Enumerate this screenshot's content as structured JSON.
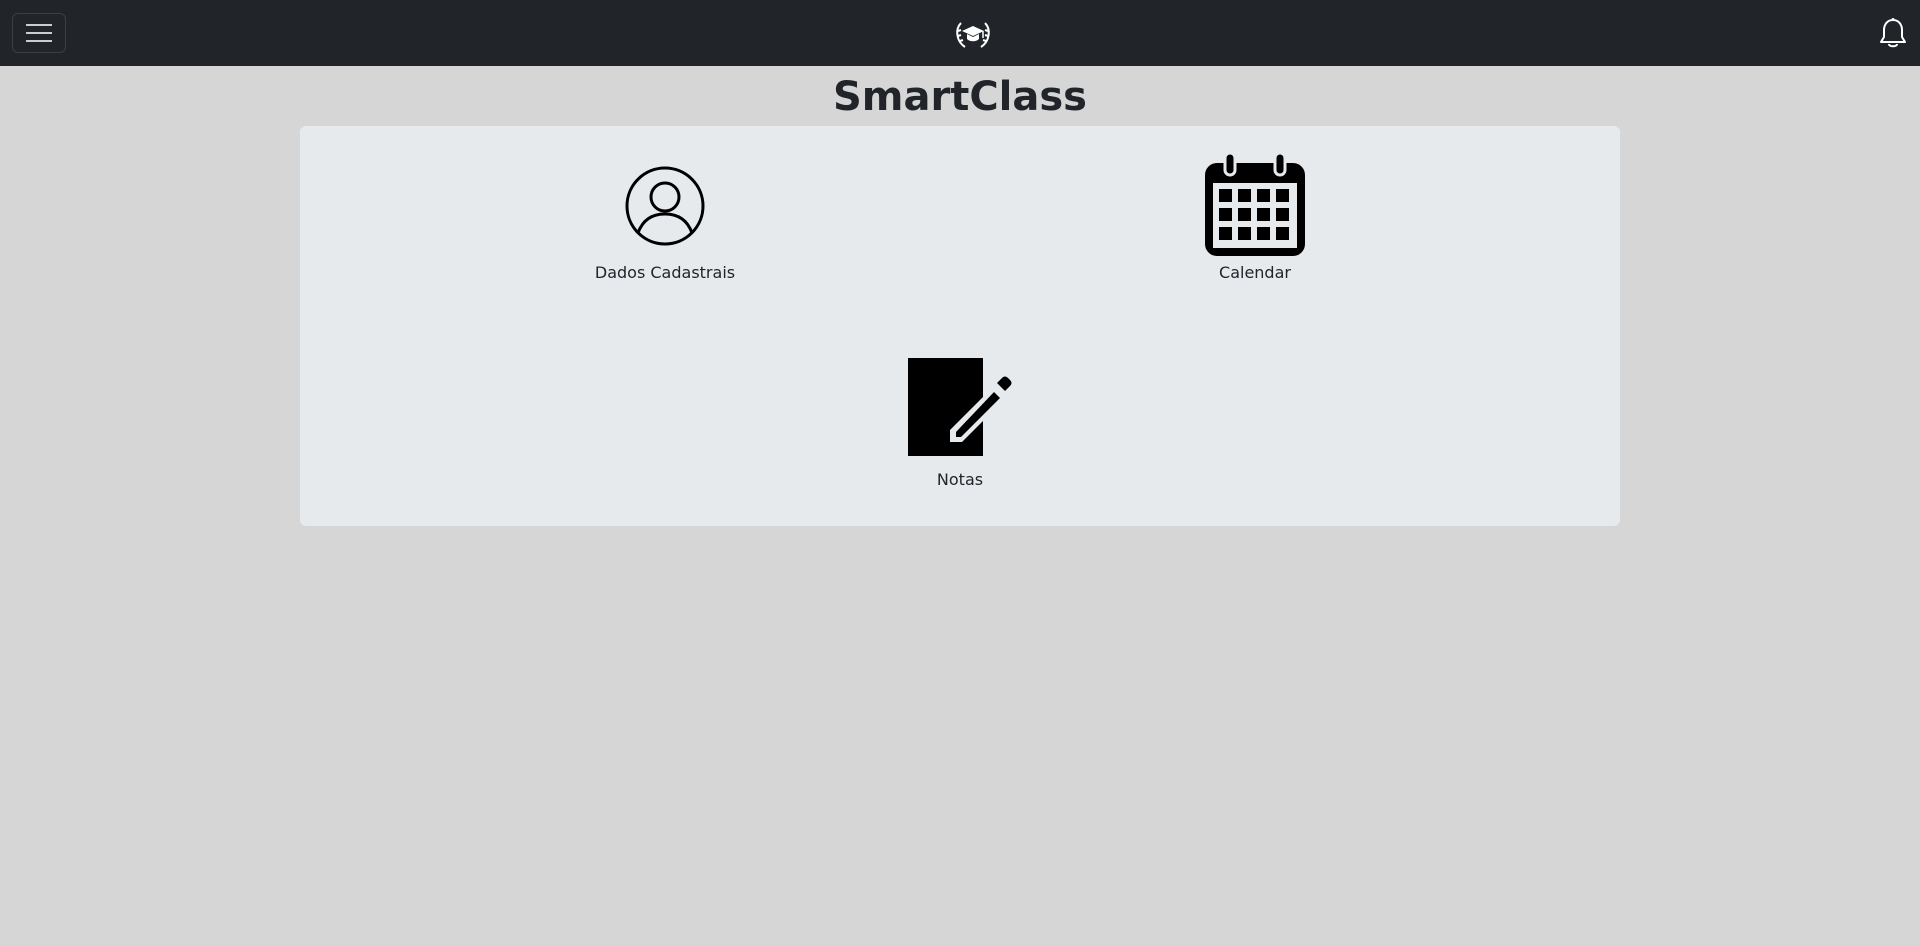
{
  "navbar": {
    "menu_icon": "hamburger-menu-icon",
    "logo_icon": "graduation-cap-laurel-logo",
    "notification_icon": "bell-icon",
    "background": "#212529"
  },
  "page": {
    "title": "SmartClass"
  },
  "tiles": [
    {
      "label": "Dados Cadastrais",
      "icon": "person-circle-icon"
    },
    {
      "label": "Calendar",
      "icon": "calendar-icon"
    },
    {
      "label": "Notas",
      "icon": "pencil-square-icon"
    }
  ]
}
